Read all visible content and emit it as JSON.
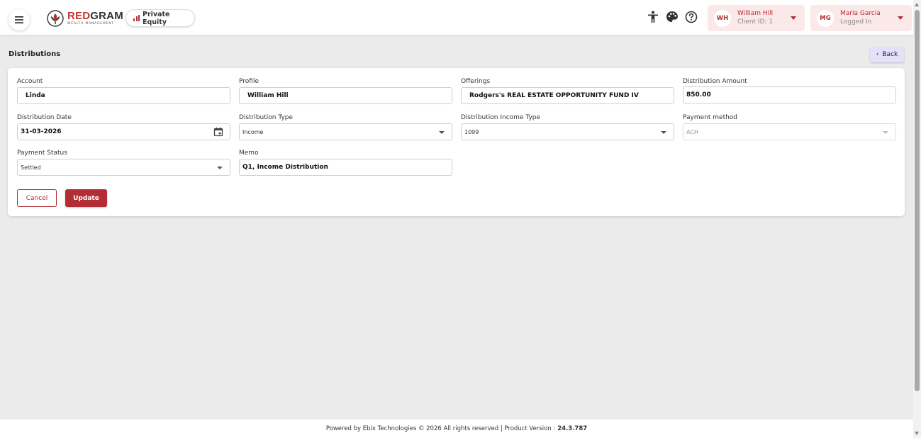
{
  "header": {
    "brand_name_red": "RED",
    "brand_name_rest": "GRAM",
    "brand_tagline": "WEALTH MANAGEMENT",
    "module_label": "Private Equity",
    "client_card": {
      "initials": "WH",
      "name": "William Hill",
      "sub": "Client ID: 1"
    },
    "user_card": {
      "initials": "MG",
      "name": "Maria Garcia",
      "sub": "Logged In"
    }
  },
  "page": {
    "title": "Distributions",
    "back_label": "Back"
  },
  "form": {
    "account": {
      "label": "Account",
      "value": "Linda"
    },
    "profile": {
      "label": "Profile",
      "value": "William Hill"
    },
    "offerings": {
      "label": "Offerings",
      "value": "Rodgers's REAL ESTATE OPPORTUNITY FUND IV"
    },
    "distribution_amount": {
      "label": "Distribution Amount",
      "value": "850.00"
    },
    "distribution_date": {
      "label": "Distribution Date",
      "value": "31-03-2026"
    },
    "distribution_type": {
      "label": "Distribution Type",
      "value": "Income"
    },
    "distribution_income_type": {
      "label": "Distribution Income Type",
      "value": "1099"
    },
    "payment_method": {
      "label": "Payment method",
      "value": "ACH"
    },
    "payment_status": {
      "label": "Payment Status",
      "value": "Settled"
    },
    "memo": {
      "label": "Memo",
      "value": "Q1, Income Distribution"
    },
    "cancel_label": "Cancel",
    "update_label": "Update"
  },
  "footer": {
    "text": "Powered by Ebix Technologies © 2026 All rights reserved | Product Version :",
    "version": "24.3.787"
  },
  "colors": {
    "accent": "#b32d35",
    "card_bg": "#fbe9e9",
    "back_bg": "#e6e0fb",
    "page_bg": "#ebebeb"
  }
}
